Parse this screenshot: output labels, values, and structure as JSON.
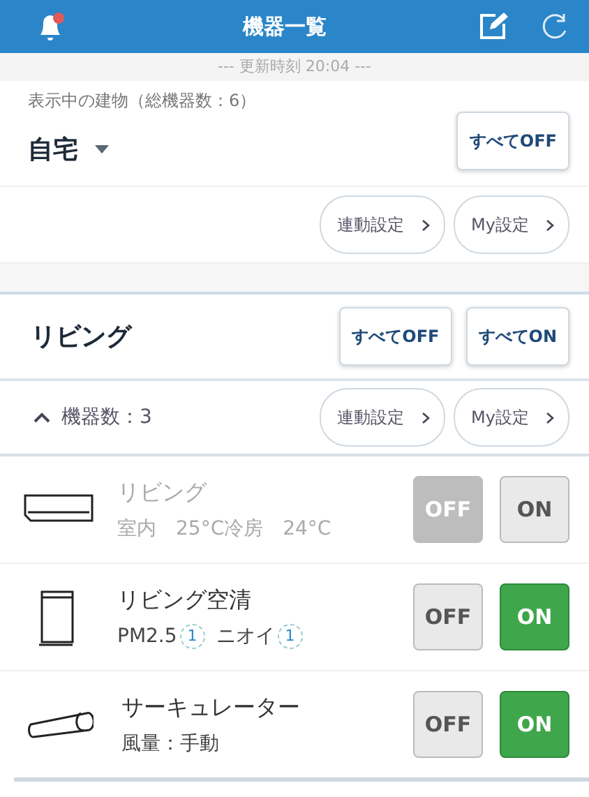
{
  "header": {
    "title": "機器一覧",
    "notification": true
  },
  "updated": "--- 更新時刻 20:04 ---",
  "building": {
    "label": "表示中の建物（総機器数：6）",
    "name": "自宅",
    "all_off": "すべてOFF",
    "links": [
      "連動設定",
      "My設定"
    ]
  },
  "room": {
    "name": "リビング",
    "all_off": "すべてOFF",
    "all_on": "すべてON",
    "expanded": true,
    "count": "機器数：3",
    "links": [
      "連動設定",
      "My設定"
    ],
    "devices": [
      {
        "kind": "aircon",
        "name": "リビング",
        "on": false,
        "status": [
          {
            "text": "室内　25°C冷房　24°C"
          }
        ],
        "off_label": "OFF",
        "on_label": "ON"
      },
      {
        "kind": "purifier",
        "name": "リビング空清",
        "on": true,
        "status": [
          {
            "text": "PM2.5",
            "badge": "1"
          },
          {
            "text": "ニオイ",
            "badge": "1"
          }
        ],
        "off_label": "OFF",
        "on_label": "ON"
      },
      {
        "kind": "circulator",
        "name": "サーキュレーター",
        "on": true,
        "status": [
          {
            "text": "風量：手動"
          }
        ],
        "off_label": "OFF",
        "on_label": "ON"
      }
    ]
  }
}
